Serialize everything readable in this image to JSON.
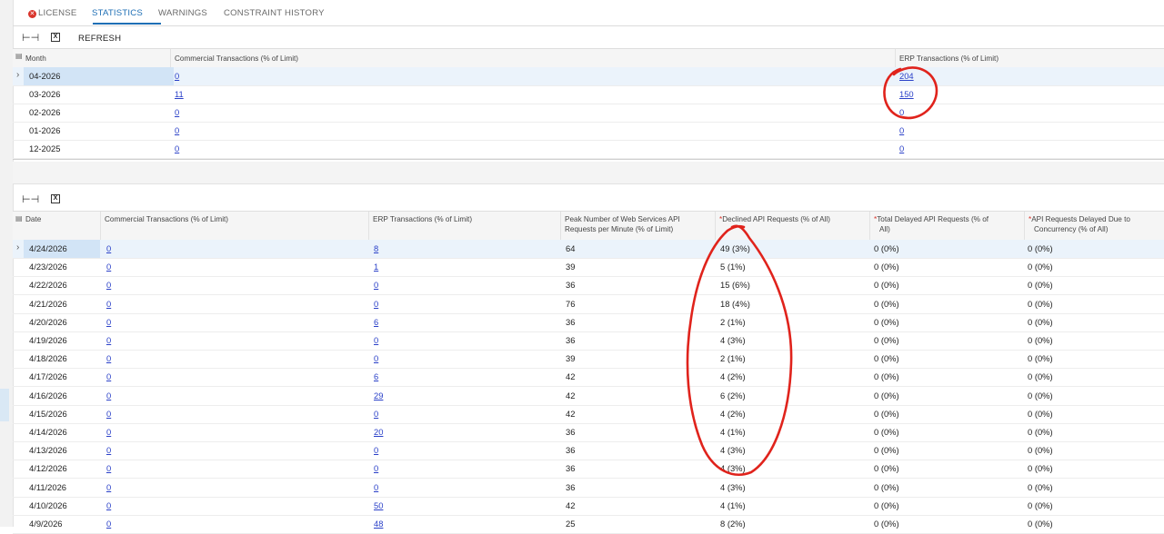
{
  "tabs": [
    {
      "label": "LICENSE",
      "has_error": true
    },
    {
      "label": "STATISTICS",
      "active": true
    },
    {
      "label": "WARNINGS"
    },
    {
      "label": "CONSTRAINT HISTORY"
    }
  ],
  "toolbar1": {
    "refresh_label": "REFRESH"
  },
  "monthly": {
    "headers": [
      "Month",
      "Commercial Transactions (% of Limit)",
      "ERP Transactions (% of Limit)"
    ],
    "rows": [
      {
        "month": "04-2026",
        "commercial": "0",
        "erp": "204"
      },
      {
        "month": "03-2026",
        "commercial": "11",
        "erp": "150"
      },
      {
        "month": "02-2026",
        "commercial": "0",
        "erp": "0"
      },
      {
        "month": "01-2026",
        "commercial": "0",
        "erp": "0"
      },
      {
        "month": "12-2025",
        "commercial": "0",
        "erp": "0"
      }
    ]
  },
  "daily": {
    "headers": {
      "date": "Date",
      "commercial": "Commercial Transactions (% of Limit)",
      "erp": "ERP Transactions (% of Limit)",
      "peak_1": "Peak Number of Web Services API",
      "peak_2": "Requests per Minute (% of Limit)",
      "required_mark": "*",
      "declined": "Declined API Requests (% of All)",
      "delayed_1": "Total Delayed API Requests (% of",
      "delayed_2": "All)",
      "concurrency_1": "API Requests Delayed Due to",
      "concurrency_2": "Concurrency (% of All)"
    },
    "rows": [
      {
        "date": "4/24/2026",
        "commercial": "0",
        "erp": "8",
        "peak": "64",
        "declined": "49 (3%)",
        "delayed": "0 (0%)",
        "concurrency": "0 (0%)"
      },
      {
        "date": "4/23/2026",
        "commercial": "0",
        "erp": "1",
        "peak": "39",
        "declined": "5 (1%)",
        "delayed": "0 (0%)",
        "concurrency": "0 (0%)"
      },
      {
        "date": "4/22/2026",
        "commercial": "0",
        "erp": "0",
        "peak": "36",
        "declined": "15 (6%)",
        "delayed": "0 (0%)",
        "concurrency": "0 (0%)"
      },
      {
        "date": "4/21/2026",
        "commercial": "0",
        "erp": "0",
        "peak": "76",
        "declined": "18 (4%)",
        "delayed": "0 (0%)",
        "concurrency": "0 (0%)"
      },
      {
        "date": "4/20/2026",
        "commercial": "0",
        "erp": "6",
        "peak": "36",
        "declined": "2 (1%)",
        "delayed": "0 (0%)",
        "concurrency": "0 (0%)"
      },
      {
        "date": "4/19/2026",
        "commercial": "0",
        "erp": "0",
        "peak": "36",
        "declined": "4 (3%)",
        "delayed": "0 (0%)",
        "concurrency": "0 (0%)"
      },
      {
        "date": "4/18/2026",
        "commercial": "0",
        "erp": "0",
        "peak": "39",
        "declined": "2 (1%)",
        "delayed": "0 (0%)",
        "concurrency": "0 (0%)"
      },
      {
        "date": "4/17/2026",
        "commercial": "0",
        "erp": "6",
        "peak": "42",
        "declined": "4 (2%)",
        "delayed": "0 (0%)",
        "concurrency": "0 (0%)"
      },
      {
        "date": "4/16/2026",
        "commercial": "0",
        "erp": "29",
        "peak": "42",
        "declined": "6 (2%)",
        "delayed": "0 (0%)",
        "concurrency": "0 (0%)"
      },
      {
        "date": "4/15/2026",
        "commercial": "0",
        "erp": "0",
        "peak": "42",
        "declined": "4 (2%)",
        "delayed": "0 (0%)",
        "concurrency": "0 (0%)"
      },
      {
        "date": "4/14/2026",
        "commercial": "0",
        "erp": "20",
        "peak": "36",
        "declined": "4 (1%)",
        "delayed": "0 (0%)",
        "concurrency": "0 (0%)"
      },
      {
        "date": "4/13/2026",
        "commercial": "0",
        "erp": "0",
        "peak": "36",
        "declined": "4 (3%)",
        "delayed": "0 (0%)",
        "concurrency": "0 (0%)"
      },
      {
        "date": "4/12/2026",
        "commercial": "0",
        "erp": "0",
        "peak": "36",
        "declined": "4 (3%)",
        "delayed": "0 (0%)",
        "concurrency": "0 (0%)"
      },
      {
        "date": "4/11/2026",
        "commercial": "0",
        "erp": "0",
        "peak": "36",
        "declined": "4 (3%)",
        "delayed": "0 (0%)",
        "concurrency": "0 (0%)"
      },
      {
        "date": "4/10/2026",
        "commercial": "0",
        "erp": "50",
        "peak": "42",
        "declined": "4 (1%)",
        "delayed": "0 (0%)",
        "concurrency": "0 (0%)"
      },
      {
        "date": "4/9/2026",
        "commercial": "0",
        "erp": "48",
        "peak": "25",
        "declined": "8 (2%)",
        "delayed": "0 (0%)",
        "concurrency": "0 (0%)"
      }
    ]
  },
  "colors": {
    "accent": "#1f6fb5",
    "link": "#2a40c8",
    "annotation": "#e0231c"
  }
}
